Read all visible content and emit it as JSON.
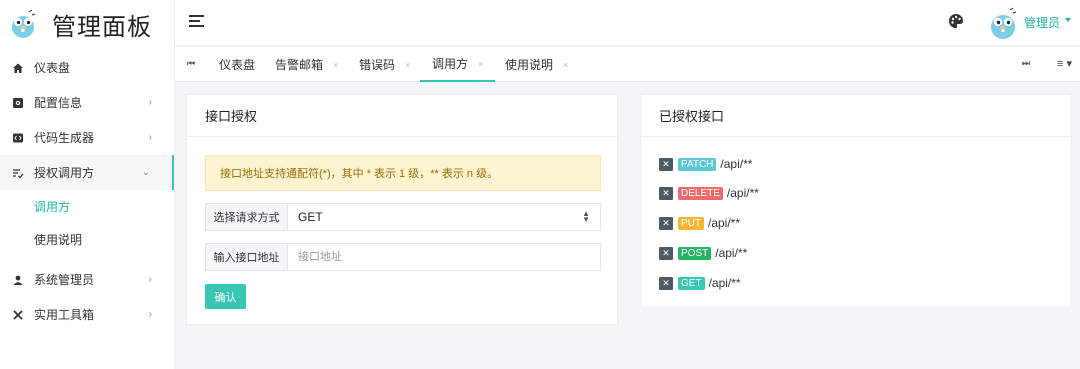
{
  "app": {
    "title": "管理面板"
  },
  "sidebar": {
    "items": [
      {
        "label": "仪表盘",
        "icon": "home-icon"
      },
      {
        "label": "配置信息",
        "icon": "gear-icon"
      },
      {
        "label": "代码生成器",
        "icon": "code-icon"
      },
      {
        "label": "授权调用方",
        "icon": "list-check-icon"
      },
      {
        "label": "系统管理员",
        "icon": "user-icon"
      },
      {
        "label": "实用工具箱",
        "icon": "tools-icon"
      }
    ],
    "subitems": [
      {
        "label": "调用方"
      },
      {
        "label": "使用说明"
      }
    ]
  },
  "header": {
    "username": "管理员"
  },
  "tabs": [
    {
      "label": "仪表盘"
    },
    {
      "label": "告警邮箱"
    },
    {
      "label": "错误码"
    },
    {
      "label": "调用方"
    },
    {
      "label": "使用说明"
    }
  ],
  "left_card": {
    "title": "接口授权",
    "alert": "接口地址支持通配符(*)，其中 * 表示 1 级，** 表示 n 级。",
    "method_label": "选择请求方式",
    "method_value": "GET",
    "path_label": "输入接口地址",
    "path_placeholder": "接口地址",
    "confirm": "确认"
  },
  "right_card": {
    "title": "已授权接口",
    "apis": [
      {
        "method": "PATCH",
        "path": "/api/**",
        "color": "#5bc8d4"
      },
      {
        "method": "DELETE",
        "path": "/api/**",
        "color": "#ef6a6a"
      },
      {
        "method": "PUT",
        "path": "/api/**",
        "color": "#f5b532"
      },
      {
        "method": "POST",
        "path": "/api/**",
        "color": "#28b463"
      },
      {
        "method": "GET",
        "path": "/api/**",
        "color": "#3bc6b3"
      }
    ]
  },
  "colors": {
    "accent": "#3bc6b3"
  }
}
